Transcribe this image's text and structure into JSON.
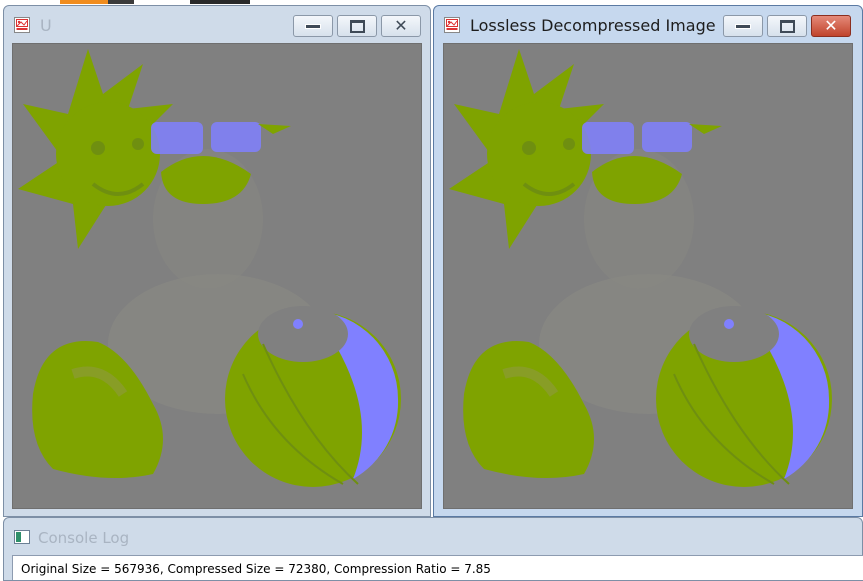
{
  "windows": {
    "left": {
      "title": "U"
    },
    "right": {
      "title": "Lossless Decompressed Image"
    }
  },
  "console": {
    "title": "Console Log",
    "line": "Original Size = 567936, Compressed Size = 72380, Compression Ratio = 7.85"
  },
  "colors": {
    "image_background": "#808080",
    "olive": "#7fa300",
    "violet": "#8080ff",
    "close_button_active": "#c0432b"
  },
  "icons": {
    "app": "image-app-icon",
    "minimize": "minimize-icon",
    "maximize": "maximize-icon",
    "close": "close-icon",
    "console": "console-window-icon"
  }
}
